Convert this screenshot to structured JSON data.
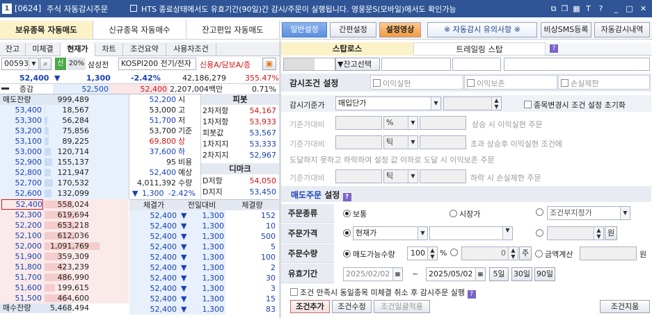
{
  "title": {
    "badge": "1",
    "code": "[0624]",
    "name": "주식 자동감시주문",
    "notice_icon": "notice-square-icon",
    "notice": "HTS 종료상태에서도 유효기간(90일)간 감시/주문이 실행됩니다. 영웅문S(모바일)에서도 확인가능",
    "icons": [
      "link-icon",
      "restore-icon",
      "grid-icon",
      "font-icon",
      "help-icon",
      "minimize-icon",
      "maximize-icon",
      "close-icon"
    ],
    "icon_glyphs": [
      "⧉",
      "❐",
      "▦",
      "T",
      "?",
      "_",
      "□",
      "✕"
    ]
  },
  "main_tabs": [
    "보유종목 자동매도",
    "신규종목 자동매수",
    "잔고편입 자동매도"
  ],
  "right_buttons": {
    "normal": "일반설정",
    "simple": "간편설정",
    "video": "설정영상",
    "caution": "※ 자동감시 유의사항 ※",
    "sms": "비상SMS등록",
    "history": "자동감시내역"
  },
  "sub_tabs": [
    "잔고",
    "미체결",
    "현재가",
    "차트",
    "조건요약",
    "사용자조건"
  ],
  "stock": {
    "code": "005930",
    "margin_tag": "신",
    "margin": "20%",
    "name": "삼성전",
    "index": "KOSPI200 전기/전자",
    "credit": "신용A/담보A/증",
    "price": "52,400",
    "arrow": "▼",
    "change": "1,300",
    "rate": "-2.42%",
    "volume": "42,186,279",
    "vol_rate": "355.47%",
    "sub_label": "증감",
    "sub_price1": "52,500",
    "sub_price2": "52,400",
    "sub_amount": "2,207,004백만",
    "sub_rate": "0.71%"
  },
  "hoga": {
    "sell_header": "매도잔량",
    "buy_footer": "매수잔량",
    "sell_total": "999,489",
    "buy_total": "5,468,494",
    "asks": [
      [
        "53,400",
        "18,567"
      ],
      [
        "53,300",
        "56,284"
      ],
      [
        "53,200",
        "75,856"
      ],
      [
        "53,100",
        "89,225"
      ],
      [
        "53,000",
        "120,714"
      ],
      [
        "52,900",
        "155,137"
      ],
      [
        "52,800",
        "121,947"
      ],
      [
        "52,700",
        "170,532"
      ],
      [
        "52,600",
        "132,099"
      ],
      [
        "52,500",
        "59,128"
      ]
    ],
    "bids": [
      [
        "52,400",
        "558,024"
      ],
      [
        "52,300",
        "619,694"
      ],
      [
        "52,200",
        "653,218"
      ],
      [
        "52,100",
        "612,036"
      ],
      [
        "52,000",
        "1,091,769"
      ],
      [
        "51,900",
        "359,309"
      ],
      [
        "51,800",
        "423,239"
      ],
      [
        "51,700",
        "486,990"
      ],
      [
        "51,600",
        "199,615"
      ],
      [
        "51,500",
        "464,600"
      ]
    ]
  },
  "info": [
    [
      "52,200",
      "시"
    ],
    [
      "53,000",
      "고"
    ],
    [
      "51,700",
      "저"
    ],
    [
      "53,700",
      "기준"
    ],
    [
      "69,800",
      "상"
    ],
    [
      "37,600",
      "하"
    ],
    [
      "95",
      "비용"
    ],
    [
      "52,400",
      "예상"
    ],
    [
      "4,011,392",
      "수량"
    ]
  ],
  "info_last": {
    "arrow": "▼",
    "change": "1,300",
    "rate": "-2.42%"
  },
  "pivot": {
    "title": "피봇",
    "rows": [
      [
        "2차저항",
        "54,167"
      ],
      [
        "1차저항",
        "53,933"
      ],
      [
        "피봇값",
        "53,567"
      ],
      [
        "1차지지",
        "53,333"
      ],
      [
        "2차지지",
        "52,967"
      ]
    ]
  },
  "demark": {
    "title": "디마크",
    "rows": [
      [
        "D저항",
        "54,050"
      ],
      [
        "D지지",
        "53,450"
      ]
    ]
  },
  "trades": {
    "headers": [
      "체결가",
      "전일대비",
      "체결량"
    ],
    "rows": [
      [
        "52,400",
        "1,300",
        "152"
      ],
      [
        "52,400",
        "1,300",
        "10"
      ],
      [
        "52,400",
        "1,300",
        "500"
      ],
      [
        "52,400",
        "1,300",
        "5"
      ],
      [
        "52,400",
        "1,300",
        "100"
      ],
      [
        "52,400",
        "1,300",
        "2"
      ],
      [
        "52,400",
        "1,300",
        "30"
      ],
      [
        "52,400",
        "1,300",
        "3"
      ],
      [
        "52,400",
        "1,300",
        "15"
      ],
      [
        "52,400",
        "1,300",
        "83"
      ]
    ]
  },
  "stop_tabs": [
    "스탑로스",
    "트레일링 스탑"
  ],
  "account": {
    "number": "",
    "balance_btn": "▼잔고선택"
  },
  "cond": {
    "title": "감시조건 설정",
    "profit": "이익실현",
    "preserve": "이익보존",
    "stoploss": "손실제한",
    "base_label": "감시기준가",
    "base_value": "매입단가",
    "reset": "종목변경시 조건 설정 초기화",
    "r1_label": "기준가대비",
    "r1_unit": "%",
    "r1_text": "상승 시  이익실현  주문",
    "r2_label": "기준가대비",
    "r2_unit": "틱",
    "r2_text": "초과 상승후 이익실현 조건에",
    "r2b_text": "도달하지 못하고 하락하여 설정 값 이하로 도달 시  이익보존 주문",
    "r3_label": "기준가대비",
    "r3_unit": "틱",
    "r3_text": "하락 시 손실제한 주문"
  },
  "order": {
    "title_a": "매도주문",
    "title_b": "설정",
    "type_label": "주문종류",
    "type_opts": [
      "보통",
      "시장가",
      "조건부지정가"
    ],
    "price_label": "주문가격",
    "price_value": "현재가",
    "won": "원",
    "qty_label": "주문수량",
    "qty_opt": "매도가능수량",
    "qty_pct": "100",
    "pct": "%",
    "qty_zero": "0",
    "ju": "주",
    "amount_opt": "금액계산",
    "valid_label": "유효기간",
    "date_from": "2025/02/02",
    "tilde": "~",
    "date_to": "2025/05/02",
    "d5": "5일",
    "d30": "30일",
    "d90": "90일"
  },
  "bottom": {
    "cancel_text": "조건 만족시 동일종목 미체결 취소 후 감시주문 실행",
    "add": "조건추가",
    "modify": "조건수정",
    "batch": "조건일괄적용",
    "delete": "조건지움"
  }
}
